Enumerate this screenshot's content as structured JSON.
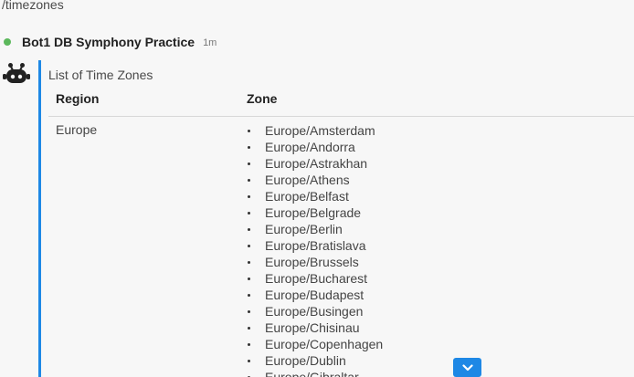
{
  "command": {
    "text": "/timezones"
  },
  "message": {
    "sender": "Bot1 DB Symphony Practice",
    "timestamp": "1m",
    "status_color": "#5cb85c",
    "accent_color": "#1e88e5"
  },
  "card": {
    "title": "List of Time Zones",
    "columns": {
      "region": "Region",
      "zone": "Zone"
    },
    "rows": [
      {
        "region": "Europe",
        "zones": [
          "Europe/Amsterdam",
          "Europe/Andorra",
          "Europe/Astrakhan",
          "Europe/Athens",
          "Europe/Belfast",
          "Europe/Belgrade",
          "Europe/Berlin",
          "Europe/Bratislava",
          "Europe/Brussels",
          "Europe/Bucharest",
          "Europe/Budapest",
          "Europe/Busingen",
          "Europe/Chisinau",
          "Europe/Copenhagen",
          "Europe/Dublin",
          "Europe/Gibraltar"
        ]
      }
    ]
  },
  "icons": {
    "avatar": "robot-icon",
    "scroll": "chevron-down-icon"
  }
}
